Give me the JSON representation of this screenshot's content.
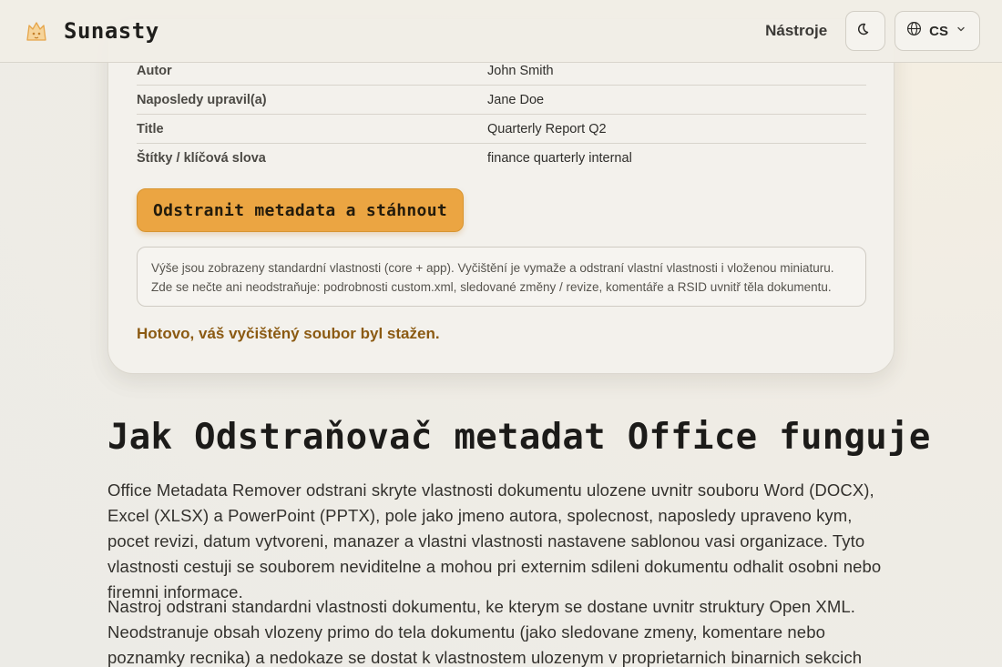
{
  "header": {
    "brand": "Sunasty",
    "nav_tools": "Nástroje",
    "lang_code": "CS"
  },
  "metadata": {
    "rows": [
      {
        "key": "Autor",
        "value": "John Smith"
      },
      {
        "key": "Naposledy upravil(a)",
        "value": "Jane Doe"
      },
      {
        "key": "Title",
        "value": "Quarterly Report Q2"
      },
      {
        "key": "Štítky / klíčová slova",
        "value": "finance quarterly internal"
      }
    ]
  },
  "action": {
    "label": "Odstranit metadata a stáhnout"
  },
  "note": {
    "text": "Výše jsou zobrazeny standardní vlastnosti (core + app). Vyčištění je vymaže a odstraní vlastní vlastnosti i vloženou miniaturu. Zde se nečte ani neodstraňuje: podrobnosti custom.xml, sledované změny / revize, komentáře a RSID uvnitř těla dokumentu."
  },
  "status": {
    "success": "Hotovo, váš vyčištěný soubor byl stažen."
  },
  "article": {
    "title": "Jak Odstraňovač metadat Office funguje",
    "p1": "Office Metadata Remover odstrani skryte vlastnosti dokumentu ulozene uvnitr souboru Word (DOCX), Excel (XLSX) a PowerPoint (PPTX), pole jako jmeno autora, spolecnost, naposledy upraveno kym, pocet revizi, datum vytvoreni, manazer a vlastni vlastnosti nastavene sablonou vasi organizace. Tyto vlastnosti cestuji se souborem neviditelne a mohou pri externim sdileni dokumentu odhalit osobni nebo firemni informace.",
    "p2": "Nastroj odstrani standardni vlastnosti dokumentu, ke kterym se dostane uvnitr struktury Open XML. Neodstranuje obsah vlozeny primo do tela dokumentu (jako sledovane zmeny, komentare nebo poznamky recnika) a nedokaze se dostat k vlastnostem ulozenym v proprietarnich binarnich sekcich nekterych starsich"
  },
  "colors": {
    "accent": "#eba542",
    "success_text": "#8b5a12",
    "background": "#efece5"
  }
}
